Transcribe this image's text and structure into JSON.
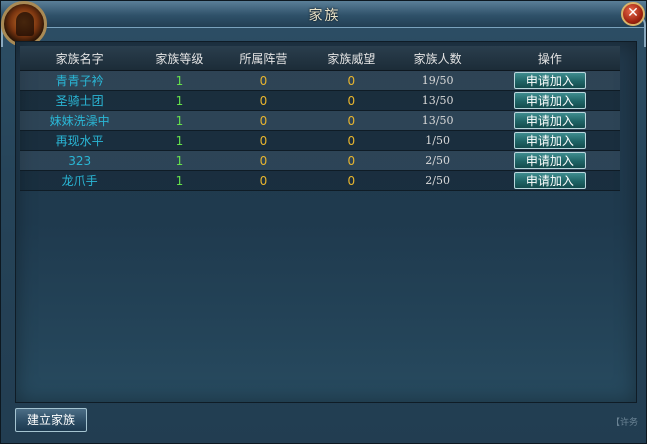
{
  "window": {
    "title": "家族"
  },
  "table": {
    "headers": [
      "家族名字",
      "家族等级",
      "所属阵营",
      "家族威望",
      "家族人数",
      "操作"
    ],
    "rows": [
      {
        "name": "青青子衿",
        "level": "1",
        "camp": "0",
        "prestige": "0",
        "members": "19/50",
        "action": "申请加入"
      },
      {
        "name": "圣骑士团",
        "level": "1",
        "camp": "0",
        "prestige": "0",
        "members": "13/50",
        "action": "申请加入"
      },
      {
        "name": "妹妹洗澡中",
        "level": "1",
        "camp": "0",
        "prestige": "0",
        "members": "13/50",
        "action": "申请加入"
      },
      {
        "name": "再现水平",
        "level": "1",
        "camp": "0",
        "prestige": "0",
        "members": "1/50",
        "action": "申请加入"
      },
      {
        "name": "323",
        "level": "1",
        "camp": "0",
        "prestige": "0",
        "members": "2/50",
        "action": "申请加入"
      },
      {
        "name": "龙爪手",
        "level": "1",
        "camp": "0",
        "prestige": "0",
        "members": "2/50",
        "action": "申请加入"
      }
    ]
  },
  "footer": {
    "create_label": "建立家族",
    "side_text": "【许务"
  },
  "icons": {
    "emblem": "family-emblem-icon",
    "close": "close-icon"
  },
  "colors": {
    "name": "#2ab7d6",
    "level": "#64e04a",
    "camp": "#e8b52e",
    "button": "#1f6466"
  }
}
